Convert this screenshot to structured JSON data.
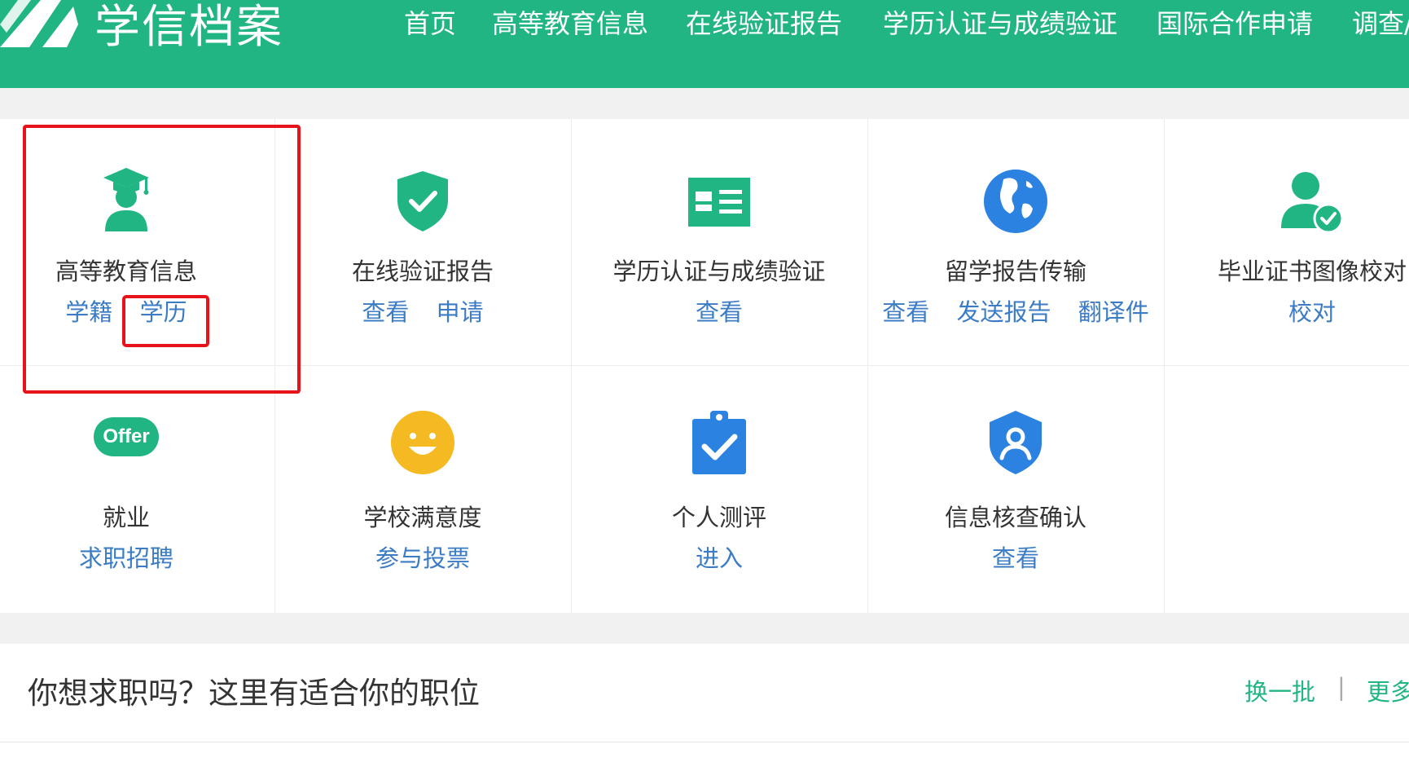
{
  "header": {
    "logo_text": "学信档案",
    "nav": [
      "首页",
      "高等教育信息",
      "在线验证报告",
      "学历认证与成绩验证",
      "国际合作申请",
      "调查/"
    ]
  },
  "services": [
    {
      "title": "高等教育信息",
      "icon": "graduate-cap-icon",
      "links": [
        "学籍",
        "学历"
      ]
    },
    {
      "title": "在线验证报告",
      "icon": "shield-check-icon",
      "links": [
        "查看",
        "申请"
      ]
    },
    {
      "title": "学历认证与成绩验证",
      "icon": "id-card-icon",
      "links": [
        "查看"
      ]
    },
    {
      "title": "留学报告传输",
      "icon": "globe-icon",
      "links": [
        "查看",
        "发送报告",
        "翻译件"
      ]
    },
    {
      "title": "毕业证书图像校对",
      "icon": "user-check-icon",
      "links": [
        "校对"
      ]
    },
    {
      "title": "就业",
      "icon": "offer-badge-icon",
      "icon_text": "Offer",
      "links": [
        "求职招聘"
      ]
    },
    {
      "title": "学校满意度",
      "icon": "smiley-icon",
      "links": [
        "参与投票"
      ]
    },
    {
      "title": "个人测评",
      "icon": "clipboard-check-icon",
      "links": [
        "进入"
      ]
    },
    {
      "title": "信息核查确认",
      "icon": "user-shield-icon",
      "links": [
        "查看"
      ]
    }
  ],
  "jobs": {
    "title": "你想求职吗？这里有适合你的职位",
    "refresh": "换一批",
    "separator": "|",
    "more": "更多"
  },
  "colors": {
    "brand_green": "#22b584",
    "link_blue": "#3b7cc4",
    "icon_blue": "#2b82e0",
    "icon_yellow": "#f5b921",
    "highlight_red": "#e8131a"
  }
}
